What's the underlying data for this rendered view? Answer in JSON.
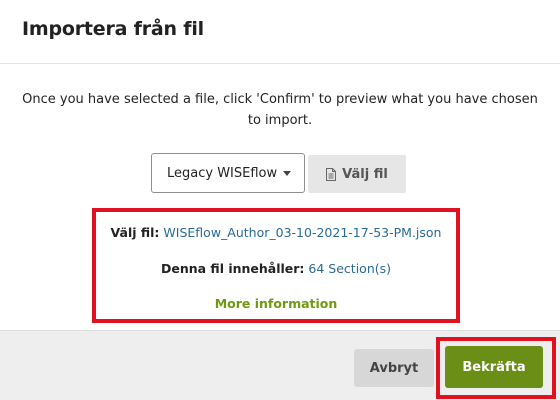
{
  "dialog": {
    "title": "Importera från fil",
    "instruction": "Once you have selected a file, click 'Confirm' to preview what you have chosen to import."
  },
  "import": {
    "format_select": {
      "selected": "Legacy WISEflow",
      "icon": "chevron-down-icon"
    },
    "choose_file_button": {
      "label": "Välj fil",
      "icon": "file-icon"
    }
  },
  "file_info": {
    "file_label": "Välj fil:",
    "file_name": "WISEflow_Author_03-10-2021-17-53-PM.json",
    "contents_label": "Denna fil innehåller:",
    "contents_value": "64 Section(s)",
    "more_info": "More information"
  },
  "footer": {
    "cancel_label": "Avbryt",
    "confirm_label": "Bekräfta"
  },
  "colors": {
    "link": "#2a6a94",
    "more_info": "#6e9a11",
    "confirm_button": "#6a8e16",
    "highlight_border": "#e1121f"
  }
}
